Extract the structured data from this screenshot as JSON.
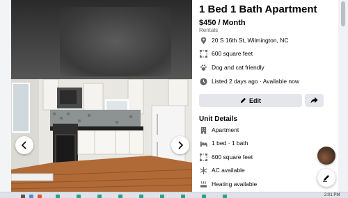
{
  "listing": {
    "title": "1 Bed 1 Bath Apartment",
    "price": "$450 / Month",
    "category": "Rentals",
    "address": "20 S 16th St, Wilmington, NC",
    "size": "600 square feet",
    "pets": "Dog and cat friendly",
    "listed": "Listed 2 days ago · Available now"
  },
  "actions": {
    "edit_label": "Edit"
  },
  "unit_details": {
    "heading": "Unit Details",
    "items": [
      {
        "icon": "apartment-icon",
        "label": "Apartment"
      },
      {
        "icon": "bed-icon",
        "label": "1 bed · 1 bath"
      },
      {
        "icon": "area-icon",
        "label": "600 square feet"
      },
      {
        "icon": "snowflake-icon",
        "label": "AC available"
      },
      {
        "icon": "heating-icon",
        "label": "Heating available"
      }
    ]
  },
  "taskbar": {
    "clock": "2:01 PM"
  },
  "colors": {
    "panel_bg": "#ffffff",
    "button_bg": "#e4e6eb",
    "text_primary": "#050505",
    "text_secondary": "#65676b",
    "icon_gray": "#65676b"
  }
}
